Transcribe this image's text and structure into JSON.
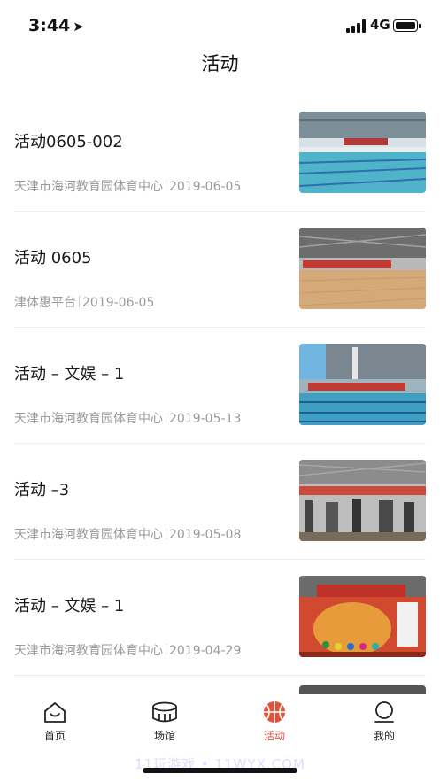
{
  "status_bar": {
    "time": "3:44",
    "network": "4G"
  },
  "page_title": "活动",
  "activities": [
    {
      "title": "活动0605-002",
      "venue": "天津市海河教育园体育中心",
      "date": "2019-06-05",
      "thumb": "swimming-pool"
    },
    {
      "title": "活动 0605",
      "venue": "津体惠平台",
      "date": "2019-06-05",
      "thumb": "gym-floor"
    },
    {
      "title": "活动 – 文娱 – 1",
      "venue": "天津市海河教育园体育中心",
      "date": "2019-05-13",
      "thumb": "swimming-pool-banner"
    },
    {
      "title": "活动 –3",
      "venue": "天津市海河教育园体育中心",
      "date": "2019-05-08",
      "thumb": "fitness-room"
    },
    {
      "title": "活动 – 文娱 – 1",
      "venue": "天津市海河教育园体育中心",
      "date": "2019-04-29",
      "thumb": "lounge-banner"
    }
  ],
  "tabs": [
    {
      "label": "首页",
      "icon": "home-icon"
    },
    {
      "label": "场馆",
      "icon": "stadium-icon"
    },
    {
      "label": "活动",
      "icon": "basketball-icon",
      "active": true
    },
    {
      "label": "我的",
      "icon": "profile-icon"
    }
  ],
  "colors": {
    "accent": "#e0533b",
    "divider": "#ededed",
    "meta_text": "#9a9a9a"
  },
  "watermark": "11玩游戏 • 11WYX.COM"
}
